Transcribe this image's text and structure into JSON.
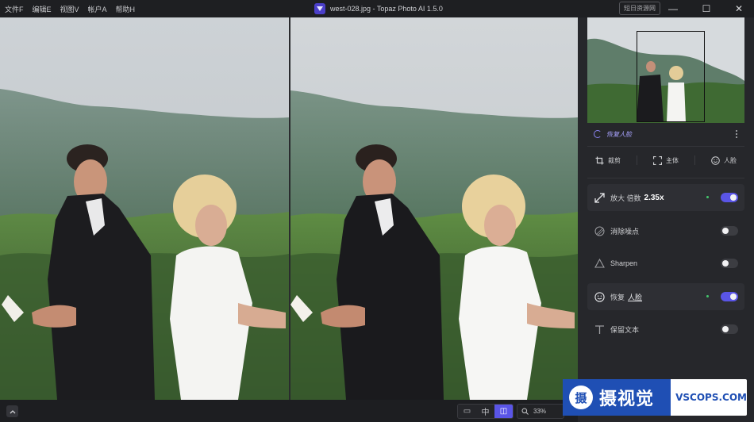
{
  "menu": [
    "文件F",
    "编辑E",
    "视图V",
    "帐户A",
    "帮助H"
  ],
  "title": "west-028.jpg - Topaz Photo AI 1.5.0",
  "titlebar_tag": "短日资源网",
  "window_controls": {
    "minimize": "—",
    "maximize": "☐",
    "close": "✕"
  },
  "bottom": {
    "view_modes": [
      "▭",
      "中",
      "◫"
    ],
    "active_view_mode": 2,
    "zoom": "33%"
  },
  "panel": {
    "face_status": "恢复人脸",
    "tools": [
      {
        "label": "裁剪",
        "icon": "crop-icon"
      },
      {
        "label": "主体",
        "icon": "subject-icon"
      },
      {
        "label": "人脸",
        "icon": "face-icon"
      }
    ],
    "features": [
      {
        "prefix": "放大 倍数",
        "value": "2.35x",
        "icon": "upscale-icon",
        "enabled": true,
        "dot": true
      },
      {
        "prefix": "消除噪点",
        "value": "",
        "icon": "denoise-icon",
        "enabled": false,
        "dot": false
      },
      {
        "prefix": "Sharpen",
        "value": "",
        "icon": "sharpen-icon",
        "enabled": false,
        "dot": false
      },
      {
        "prefix": "恢复",
        "value": "人脸",
        "icon": "face-recovery-icon",
        "enabled": true,
        "dot": true
      },
      {
        "prefix": "保留文本",
        "value": "",
        "icon": "text-icon",
        "enabled": false,
        "dot": false
      }
    ]
  },
  "watermark": {
    "badge": "摄",
    "cn": "摄视觉",
    "en": "VSCOPS.COM"
  },
  "colors": {
    "accent": "#5a55e6",
    "status_dot": "#43c46b",
    "panel_bg": "#26272b"
  }
}
